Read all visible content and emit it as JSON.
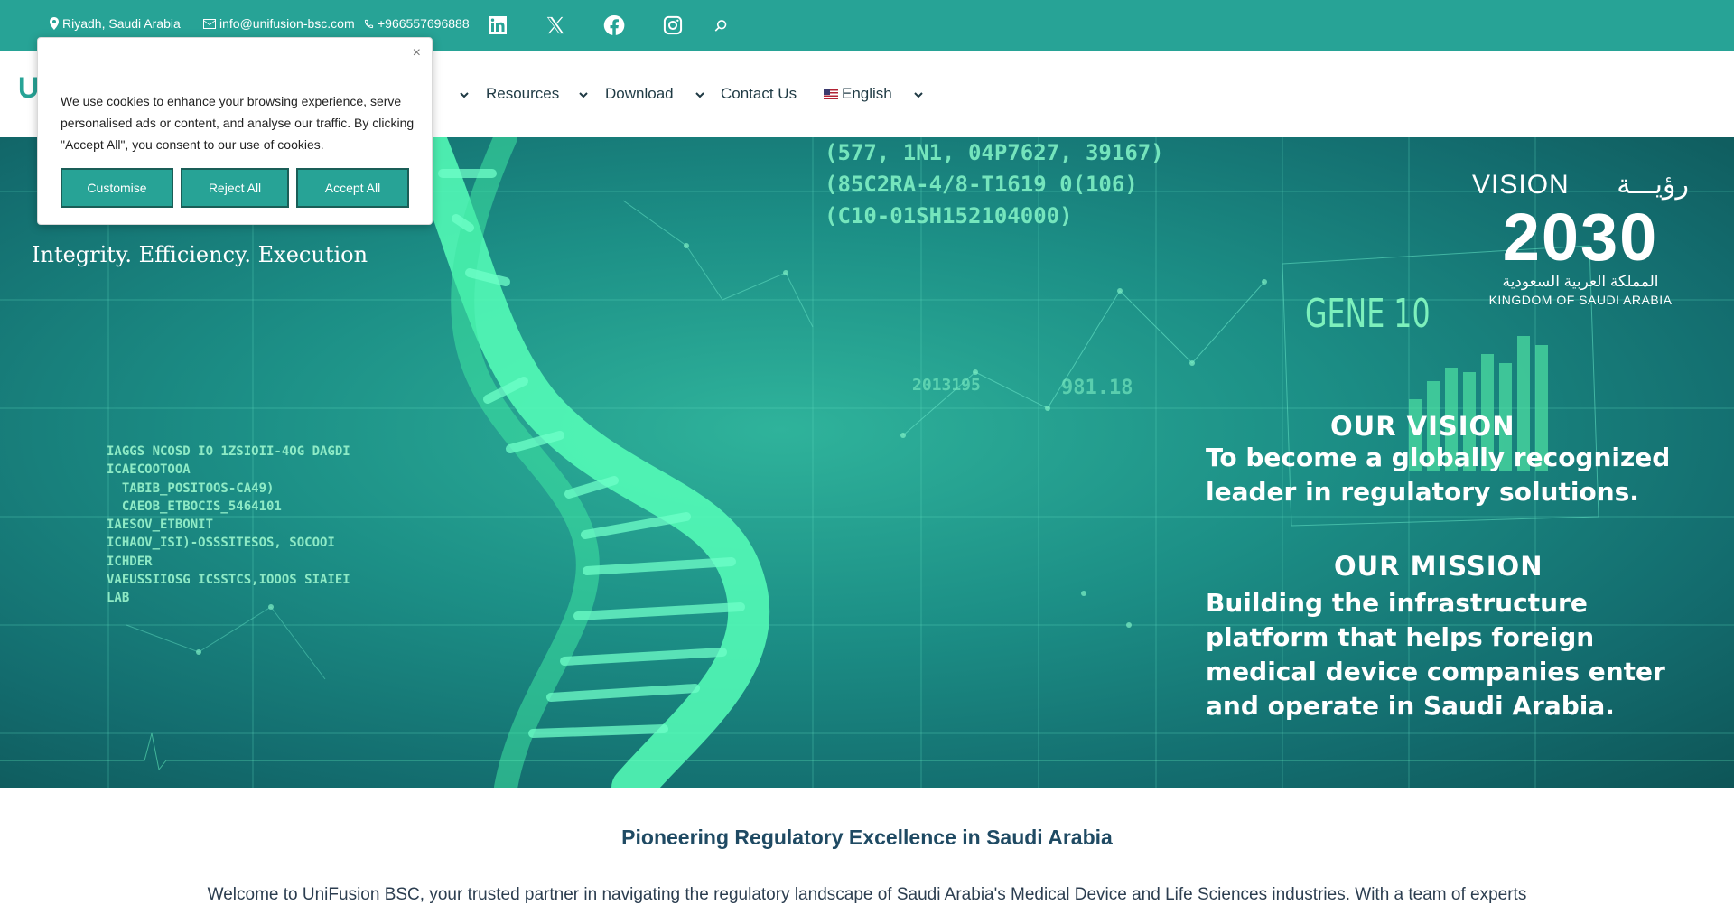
{
  "topbar": {
    "location": "Riyadh, Saudi Arabia",
    "email": "info@unifusion-bsc.com",
    "phone": "+966557696888",
    "social": [
      "linkedin-icon",
      "x-icon",
      "facebook-icon",
      "instagram-icon"
    ]
  },
  "nav": {
    "logo_partial": "U",
    "items_partial": "s",
    "resources": "Resources",
    "download": "Download",
    "contact": "Contact Us",
    "language": "English"
  },
  "hero": {
    "tagline": "Integrity. Efficiency. Execution",
    "vision_logo": {
      "word": "VISION",
      "arabic_word": "رؤيـــة",
      "year": "2030",
      "arabic_kingdom": "المملكة العربية السعودية",
      "kingdom": "KINGDOM OF SAUDI ARABIA"
    },
    "vision_heading": "OUR VISION",
    "vision_text": "To become a globally recognized leader in regulatory solutions.",
    "mission_heading": "OUR MISSION",
    "mission_text": "Building the infrastructure platform that helps foreign medical device companies enter and operate in Saudi Arabia.",
    "code_top": "(577, 1N1, 04P7627, 39167)\n(85C2RA-4/8-T1619 0(106)\n(C10-01SH152104000)",
    "code_left": "IAGGS NCOSD IO 1ZSIOII-4OG DAGDI\nICAECOOTOOA\n  TABIB_POSITOOS-CA49)\n  CAEOB_ETBOCIS_5464101\nIAESOV_ETBONIT\nICHAOV_ISI)-OSSSITESOS, SOCOOI\nICHDER\nVAEUSSIIOSG ICSSTCS,IOOOS SIAIEI\nLAB",
    "gene_text": "GENE 10",
    "data_small_1": "2013195",
    "data_small_2": "981.18"
  },
  "content": {
    "title": "Pioneering Regulatory Excellence in Saudi Arabia",
    "subtitle": "Welcome to UniFusion BSC, your trusted partner in navigating the regulatory landscape of Saudi Arabia's Medical Device and Life Sciences industries. With a team of experts"
  },
  "cookie": {
    "close_glyph": "×",
    "text": "We use cookies to enhance your browsing experience, serve personalised ads or content, and analyse our traffic. By clicking \"Accept All\", you consent to our use of cookies.",
    "customise": "Customise",
    "reject": "Reject All",
    "accept": "Accept All"
  },
  "colors": {
    "brand_teal": "#27a396",
    "nav_text": "#1f3a44",
    "heading_blue": "#1f4a63"
  }
}
